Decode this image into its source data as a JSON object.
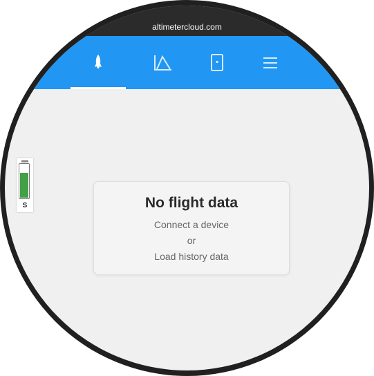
{
  "browser": {
    "url": "altimetercloud.com"
  },
  "nav": {
    "tabs": [
      {
        "icon": "rocket-icon",
        "active": true
      },
      {
        "icon": "altitude-chart-icon",
        "active": false
      },
      {
        "icon": "device-icon",
        "active": false
      },
      {
        "icon": "menu-icon",
        "active": false
      }
    ]
  },
  "battery": {
    "label": "S",
    "level": 0.75,
    "color": "#43a047"
  },
  "empty_state": {
    "title": "No flight data",
    "line1": "Connect a device",
    "line2": "or",
    "line3": "Load history data"
  },
  "colors": {
    "accent": "#2196f3",
    "bezel": "#202020",
    "background": "#f0f0f0"
  }
}
